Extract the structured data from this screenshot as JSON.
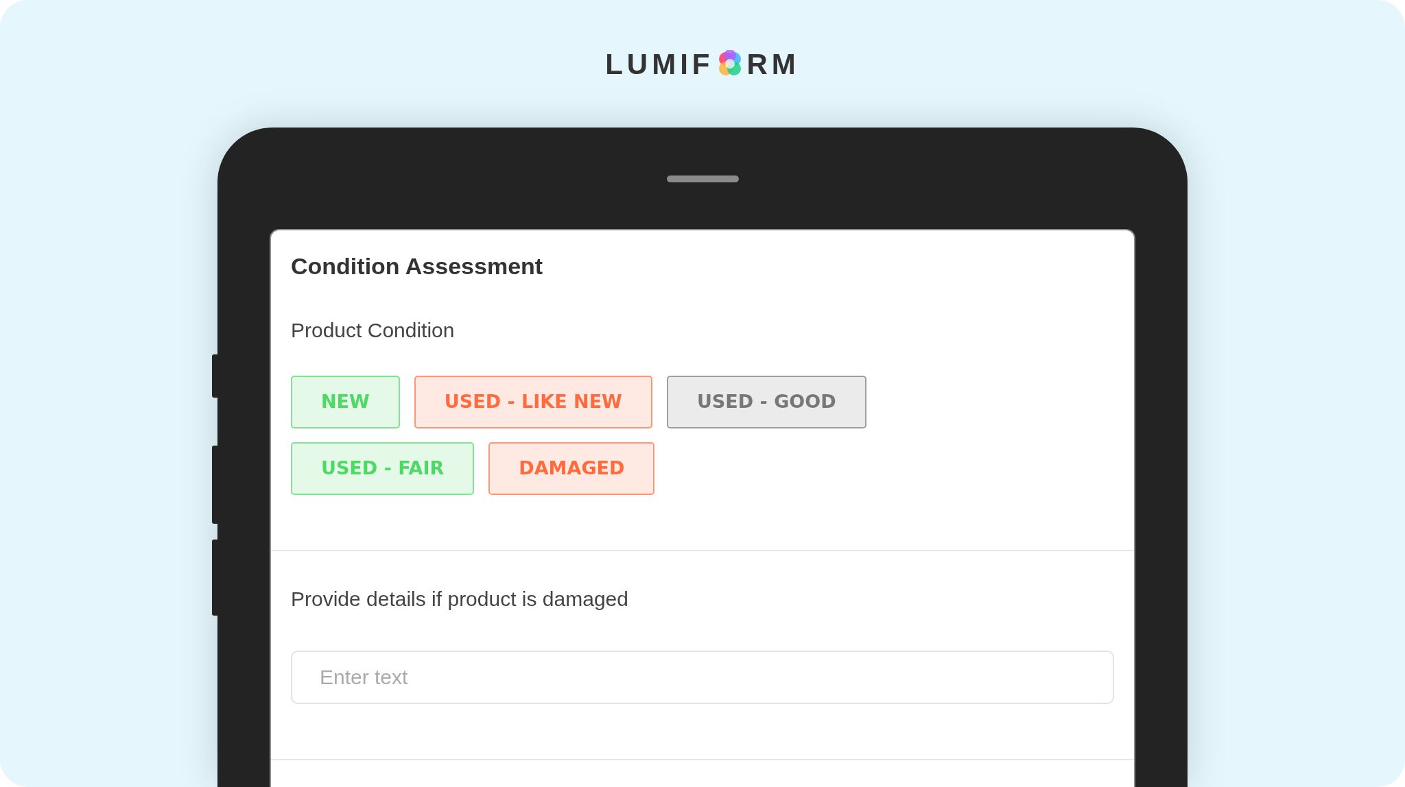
{
  "logo": {
    "text_before": "LUMIF",
    "text_after": "RM"
  },
  "form": {
    "title": "Condition Assessment",
    "condition": {
      "label": "Product Condition",
      "options": [
        {
          "label": "NEW",
          "color": "#4cd964"
        },
        {
          "label": "USED - LIKE NEW",
          "color": "#ff6b3d"
        },
        {
          "label": "USED - GOOD",
          "color": "#777777"
        },
        {
          "label": "USED - FAIR",
          "color": "#4cd964"
        },
        {
          "label": "DAMAGED",
          "color": "#ff6b3d"
        }
      ]
    },
    "details": {
      "label": "Provide details if product is damaged",
      "placeholder": "Enter text"
    }
  }
}
